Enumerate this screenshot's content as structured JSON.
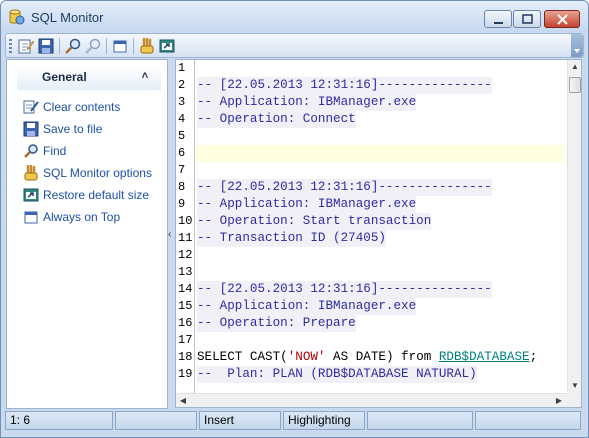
{
  "window": {
    "title": "SQL Monitor"
  },
  "toolbar": {
    "buttons": [
      "edit-icon",
      "save-icon",
      "find-icon",
      "find-next-icon",
      "always-on-top-icon",
      "options-icon",
      "restore-size-icon"
    ]
  },
  "sidebar": {
    "group_title": "General",
    "collapse_glyph": "˄",
    "items": [
      {
        "label": "Clear contents",
        "icon": "clear-icon"
      },
      {
        "label": "Save to file",
        "icon": "save-icon"
      },
      {
        "label": "Find",
        "icon": "find-icon"
      },
      {
        "label": "SQL Monitor options",
        "icon": "options-icon"
      },
      {
        "label": "Restore default size",
        "icon": "restore-size-icon"
      },
      {
        "label": "Always on Top",
        "icon": "always-on-top-icon"
      }
    ]
  },
  "editor": {
    "current_line": 6,
    "lines": [
      {
        "n": "1",
        "text": ""
      },
      {
        "n": "2",
        "text": "-- [22.05.2013 12:31:16]---------------",
        "type": "comment"
      },
      {
        "n": "3",
        "text": "-- Application: IBManager.exe",
        "type": "comment"
      },
      {
        "n": "4",
        "text": "-- Operation: Connect",
        "type": "comment"
      },
      {
        "n": "5",
        "text": ""
      },
      {
        "n": "6",
        "text": ""
      },
      {
        "n": "7",
        "text": ""
      },
      {
        "n": "8",
        "text": "-- [22.05.2013 12:31:16]---------------",
        "type": "comment"
      },
      {
        "n": "9",
        "text": "-- Application: IBManager.exe",
        "type": "comment"
      },
      {
        "n": "10",
        "text": "-- Operation: Start transaction",
        "type": "comment"
      },
      {
        "n": "11",
        "text": "-- Transaction ID (27405)",
        "type": "comment"
      },
      {
        "n": "12",
        "text": ""
      },
      {
        "n": "13",
        "text": ""
      },
      {
        "n": "14",
        "text": "-- [22.05.2013 12:31:16]---------------",
        "type": "comment"
      },
      {
        "n": "15",
        "text": "-- Application: IBManager.exe",
        "type": "comment"
      },
      {
        "n": "16",
        "text": "-- Operation: Prepare",
        "type": "comment"
      },
      {
        "n": "17",
        "text": ""
      },
      {
        "n": "18",
        "text": "SELECT CAST('NOW' AS DATE) from RDB$DATABASE;",
        "type": "sql",
        "parts": [
          "SELECT CAST(",
          "'NOW'",
          " AS DATE) from ",
          "RDB$DATABASE",
          ";"
        ]
      },
      {
        "n": "19",
        "text": "--  Plan: PLAN (RDB$DATABASE NATURAL)",
        "type": "comment"
      }
    ]
  },
  "statusbar": {
    "position": "1:   6",
    "mode": "Insert",
    "highlighting": "Highlighting"
  }
}
